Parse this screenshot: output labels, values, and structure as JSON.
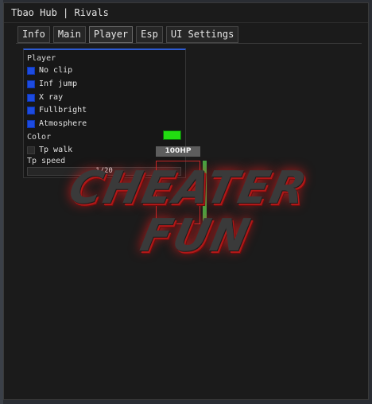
{
  "window": {
    "title": "Tbao Hub | Rivals"
  },
  "tabs": [
    {
      "label": "Info"
    },
    {
      "label": "Main"
    },
    {
      "label": "Player"
    },
    {
      "label": "Esp"
    },
    {
      "label": "UI Settings"
    }
  ],
  "active_tab": "Player",
  "player_section": {
    "title": "Player",
    "toggles": [
      {
        "label": "No clip",
        "checked": true
      },
      {
        "label": "Inf jump",
        "checked": true
      },
      {
        "label": "X ray",
        "checked": true
      },
      {
        "label": "Fullbright",
        "checked": true
      },
      {
        "label": "Atmosphere",
        "checked": true
      }
    ],
    "color": {
      "label": "Color",
      "value": "#22dd11"
    },
    "tp_walk": {
      "label": "Tp walk",
      "checked": false
    },
    "tp_speed": {
      "label": "Tp speed",
      "value": 1,
      "max": 20,
      "text": "1/20"
    }
  },
  "esp_preview": {
    "health_text": "100HP",
    "health_fraction": 1.0
  },
  "watermark": {
    "line1": "CHEATER",
    "line2": "FUN"
  },
  "colors": {
    "accent": "#2d5bd2",
    "window_bg": "#1b1b1b",
    "box": "#c32828",
    "health": "#43a843"
  }
}
